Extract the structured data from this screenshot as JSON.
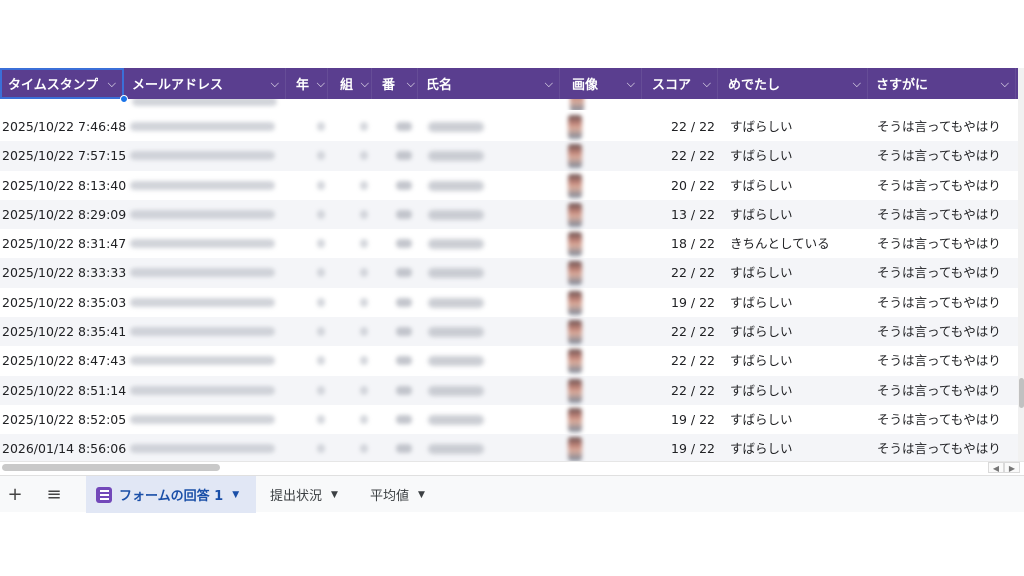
{
  "columns": [
    {
      "key": "timestamp",
      "label": "タイムスタンプ"
    },
    {
      "key": "email",
      "label": "メールアドレス"
    },
    {
      "key": "g1",
      "label": "年"
    },
    {
      "key": "g2",
      "label": "組"
    },
    {
      "key": "g3",
      "label": "番"
    },
    {
      "key": "name",
      "label": "氏名"
    },
    {
      "key": "image",
      "label": "画像"
    },
    {
      "key": "score",
      "label": "スコア"
    },
    {
      "key": "medetashi",
      "label": "めでたし"
    },
    {
      "key": "sasugani",
      "label": "さすがに"
    }
  ],
  "rows": [
    {
      "timestamp": "2025/10/22 7:46:48",
      "score": "22 / 22",
      "medetashi": "すばらしい",
      "sasugani": "そうは言ってもやはり"
    },
    {
      "timestamp": "2025/10/22 7:57:15",
      "score": "22 / 22",
      "medetashi": "すばらしい",
      "sasugani": "そうは言ってもやはり"
    },
    {
      "timestamp": "2025/10/22 8:13:40",
      "score": "20 / 22",
      "medetashi": "すばらしい",
      "sasugani": "そうは言ってもやはり"
    },
    {
      "timestamp": "2025/10/22 8:29:09",
      "score": "13 / 22",
      "medetashi": "すばらしい",
      "sasugani": "そうは言ってもやはり"
    },
    {
      "timestamp": "2025/10/22 8:31:47",
      "score": "18 / 22",
      "medetashi": "きちんとしている",
      "sasugani": "そうは言ってもやはり"
    },
    {
      "timestamp": "2025/10/22 8:33:33",
      "score": "22 / 22",
      "medetashi": "すばらしい",
      "sasugani": "そうは言ってもやはり"
    },
    {
      "timestamp": "2025/10/22 8:35:03",
      "score": "19 / 22",
      "medetashi": "すばらしい",
      "sasugani": "そうは言ってもやはり"
    },
    {
      "timestamp": "2025/10/22 8:35:41",
      "score": "22 / 22",
      "medetashi": "すばらしい",
      "sasugani": "そうは言ってもやはり"
    },
    {
      "timestamp": "2025/10/22 8:47:43",
      "score": "22 / 22",
      "medetashi": "すばらしい",
      "sasugani": "そうは言ってもやはり"
    },
    {
      "timestamp": "2025/10/22 8:51:14",
      "score": "22 / 22",
      "medetashi": "すばらしい",
      "sasugani": "そうは言ってもやはり"
    },
    {
      "timestamp": "2025/10/22 8:52:05",
      "score": "19 / 22",
      "medetashi": "すばらしい",
      "sasugani": "そうは言ってもやはり"
    },
    {
      "timestamp": "2026/01/14 8:56:06",
      "score": "19 / 22",
      "medetashi": "すばらしい",
      "sasugani": "そうは言ってもやはり"
    }
  ],
  "tabs": [
    {
      "label": "フォームの回答 1",
      "active": true
    },
    {
      "label": "提出状況",
      "active": false
    },
    {
      "label": "平均値",
      "active": false
    }
  ],
  "toolbar": {
    "add_sheet_icon": "+",
    "all_sheets_icon": "≡"
  },
  "colors": {
    "header_bg": "#5a3e8f",
    "active_tab_bg": "#e1e7f5",
    "selection": "#1a73e8"
  }
}
